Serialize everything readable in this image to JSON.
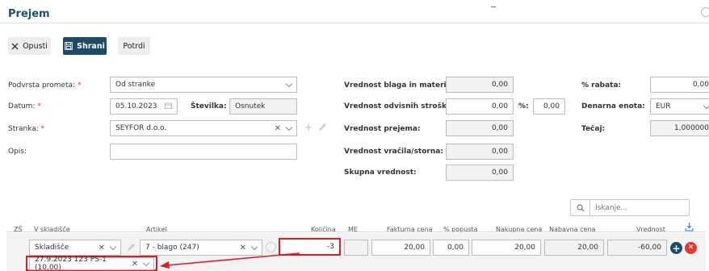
{
  "page": {
    "title": "Prejem"
  },
  "toolbar": {
    "cancel_label": "Opusti",
    "save_label": "Shrani",
    "confirm_label": "Potrdi"
  },
  "form": {
    "podvrsta_label": "Podvrsta prometa:",
    "podvrsta_value": "Od stranke",
    "datum_label": "Datum:",
    "datum_value": "05.10.2023",
    "stevilka_label": "Številka:",
    "stevilka_value": "Osnutek",
    "stranka_label": "Stranka:",
    "stranka_value": "SEYFOR d.o.o.",
    "opis_label": "Opis:",
    "opis_value": "",
    "required_mark": "*",
    "vbm_label": "Vrednost blaga in materiala:",
    "vbm_value": "0,00",
    "vos_label": "Vrednost odvisnih stroškov:",
    "vos_value": "0,00",
    "pct_label": "%:",
    "pct_value": "0,00",
    "vp_label": "Vrednost prejema:",
    "vp_value": "0,00",
    "vvs_label": "Vrednost vračila/storna:",
    "vvs_value": "0,00",
    "sv_label": "Skupna vrednost:",
    "sv_value": "0,00",
    "rabat_label": "% rabata:",
    "rabat_value": "0,00",
    "denarna_label": "Denarna enota:",
    "denarna_value": "EUR",
    "tecaj_label": "Tečaj:",
    "tecaj_value": "1,000000"
  },
  "search": {
    "placeholder": "Iskanje..."
  },
  "table": {
    "headers": {
      "zs": "ZŠ",
      "skladisce": "V skladišče",
      "artikel": "Artikel",
      "kolicina": "Količina",
      "me": "ME",
      "fakturna": "Fakturna cena",
      "popust": "% popusta",
      "nakupna": "Nakupna cena",
      "nabavna": "Nabavna cena",
      "vrednost": "Vrednost"
    },
    "row": {
      "skladisce": "Skladišče",
      "artikel": "7 - blago (247)",
      "kolicina": "-3",
      "me": "",
      "fakturna": "20,00",
      "popust": "0,00",
      "nakupna": "20,00",
      "nabavna": "20,00",
      "vrednost": "-60,00",
      "lot": "27.9.2023 123 PS-1 (10,00)"
    }
  },
  "colors": {
    "primary": "#1d4a64",
    "title": "#1f4e6e",
    "highlight": "#e01b24",
    "add": "#1d4a64",
    "remove": "#e03a2f"
  }
}
